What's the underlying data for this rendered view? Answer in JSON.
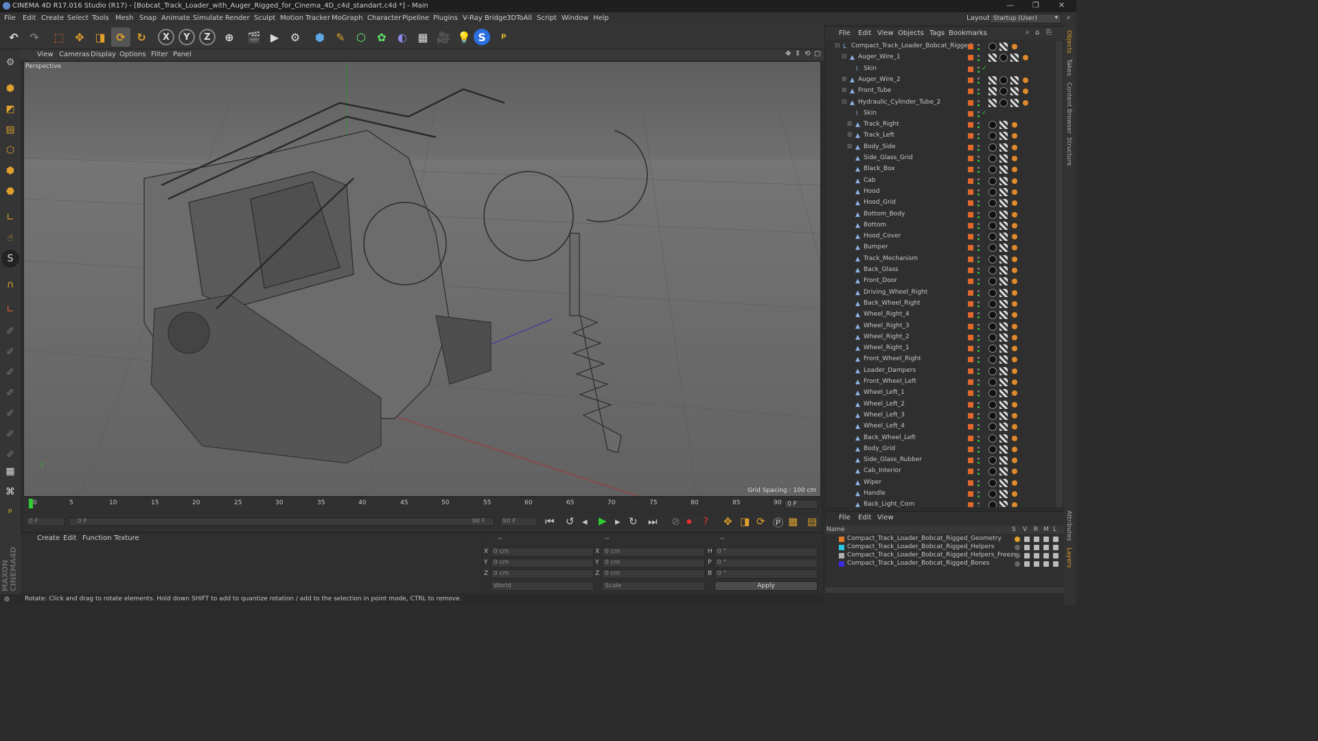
{
  "window": {
    "title": "CINEMA 4D R17.016 Studio (R17) - [Bobcat_Track_Loader_with_Auger_Rigged_for_Cinema_4D_c4d_standart.c4d *] - Main"
  },
  "menu": [
    "File",
    "Edit",
    "Create",
    "Select",
    "Tools",
    "Mesh",
    "Snap",
    "Animate",
    "Simulate",
    "Render",
    "Sculpt",
    "Motion Tracker",
    "MoGraph",
    "Character",
    "Pipeline",
    "Plugins",
    "V-Ray Bridge",
    "3DToAll",
    "Script",
    "Window",
    "Help"
  ],
  "layout": {
    "label": "Layout:",
    "value": "Startup (User)"
  },
  "viewport": {
    "menu": [
      "View",
      "Cameras",
      "Display",
      "Options",
      "Filter",
      "Panel"
    ],
    "label": "Perspective",
    "grid_spacing": "Grid Spacing : 100 cm"
  },
  "timeline": {
    "ticks": [
      "0",
      "5",
      "10",
      "15",
      "20",
      "25",
      "30",
      "35",
      "40",
      "45",
      "50",
      "55",
      "60",
      "65",
      "70",
      "75",
      "80",
      "85",
      "90"
    ],
    "end_field": "0 F",
    "start_frame": "0 F",
    "range_start": "0 F",
    "range_end": "90 F",
    "max_frame": "90 F"
  },
  "material_panel": {
    "menu": [
      "Create",
      "Edit",
      "Function",
      "Texture"
    ]
  },
  "coord_panel": {
    "header_left": "--",
    "header_mid": "--",
    "header_right": "--",
    "rows": [
      {
        "a": "X",
        "av": "0 cm",
        "b": "X",
        "bv": "0 cm",
        "c": "H",
        "cv": "0 °"
      },
      {
        "a": "Y",
        "av": "0 cm",
        "b": "Y",
        "bv": "0 cm",
        "c": "P",
        "cv": "0 °"
      },
      {
        "a": "Z",
        "av": "0 cm",
        "b": "Z",
        "bv": "0 cm",
        "c": "B",
        "cv": "0 °"
      }
    ],
    "world": "World",
    "scale": "Scale",
    "apply": "Apply"
  },
  "status": "Rotate: Click and drag to rotate elements. Hold down SHIFT to add to quantize rotation / add to the selection in point mode, CTRL to remove.",
  "object_manager": {
    "menu": [
      "File",
      "Edit",
      "View",
      "Objects",
      "Tags",
      "Bookmarks"
    ],
    "objects": [
      {
        "name": "Compact_Track_Loader_Bobcat_Rigged",
        "indent": 0,
        "type": "null"
      },
      {
        "name": "Auger_Wire_1",
        "indent": 1,
        "type": "bone"
      },
      {
        "name": "Skin",
        "indent": 2,
        "type": "skin"
      },
      {
        "name": "Auger_Wire_2",
        "indent": 1,
        "type": "bone"
      },
      {
        "name": "Front_Tube",
        "indent": 1,
        "type": "bone"
      },
      {
        "name": "Hydraulic_Cylinder_Tube_2",
        "indent": 1,
        "type": "bone"
      },
      {
        "name": "Skin",
        "indent": 2,
        "type": "skin"
      },
      {
        "name": "Track_Right",
        "indent": 2,
        "type": "bone"
      },
      {
        "name": "Track_Left",
        "indent": 2,
        "type": "bone"
      },
      {
        "name": "Body_Side",
        "indent": 2,
        "type": "bone"
      },
      {
        "name": "Side_Glass_Grid",
        "indent": 2,
        "type": "bone"
      },
      {
        "name": "Black_Box",
        "indent": 2,
        "type": "bone"
      },
      {
        "name": "Cab",
        "indent": 2,
        "type": "bone"
      },
      {
        "name": "Hood",
        "indent": 2,
        "type": "bone"
      },
      {
        "name": "Hood_Grid",
        "indent": 2,
        "type": "bone"
      },
      {
        "name": "Bottom_Body",
        "indent": 2,
        "type": "bone"
      },
      {
        "name": "Bottom",
        "indent": 2,
        "type": "bone"
      },
      {
        "name": "Hood_Cover",
        "indent": 2,
        "type": "bone"
      },
      {
        "name": "Bumper",
        "indent": 2,
        "type": "bone"
      },
      {
        "name": "Track_Mechanism",
        "indent": 2,
        "type": "bone"
      },
      {
        "name": "Back_Glass",
        "indent": 2,
        "type": "bone"
      },
      {
        "name": "Front_Door",
        "indent": 2,
        "type": "bone"
      },
      {
        "name": "Driving_Wheel_Right",
        "indent": 2,
        "type": "bone"
      },
      {
        "name": "Back_Wheel_Right",
        "indent": 2,
        "type": "bone"
      },
      {
        "name": "Wheel_Right_4",
        "indent": 2,
        "type": "bone"
      },
      {
        "name": "Wheel_Right_3",
        "indent": 2,
        "type": "bone"
      },
      {
        "name": "Wheel_Right_2",
        "indent": 2,
        "type": "bone"
      },
      {
        "name": "Wheel_Right_1",
        "indent": 2,
        "type": "bone"
      },
      {
        "name": "Front_Wheel_Right",
        "indent": 2,
        "type": "bone"
      },
      {
        "name": "Loader_Dampers",
        "indent": 2,
        "type": "bone"
      },
      {
        "name": "Front_Wheel_Left",
        "indent": 2,
        "type": "bone"
      },
      {
        "name": "Wheel_Left_1",
        "indent": 2,
        "type": "bone"
      },
      {
        "name": "Wheel_Left_2",
        "indent": 2,
        "type": "bone"
      },
      {
        "name": "Wheel_Left_3",
        "indent": 2,
        "type": "bone"
      },
      {
        "name": "Wheel_Left_4",
        "indent": 2,
        "type": "bone"
      },
      {
        "name": "Back_Wheel_Left",
        "indent": 2,
        "type": "bone"
      },
      {
        "name": "Body_Grid",
        "indent": 2,
        "type": "bone"
      },
      {
        "name": "Side_Glass_Rubber",
        "indent": 2,
        "type": "bone"
      },
      {
        "name": "Cab_Interior",
        "indent": 2,
        "type": "bone"
      },
      {
        "name": "Wiper",
        "indent": 2,
        "type": "bone"
      },
      {
        "name": "Handle",
        "indent": 2,
        "type": "bone"
      },
      {
        "name": "Back_Light_Corn",
        "indent": 2,
        "type": "bone"
      }
    ]
  },
  "layer_manager": {
    "menu": [
      "File",
      "Edit",
      "View"
    ],
    "header": {
      "name": "Name",
      "s": "S",
      "v": "V",
      "r": "R",
      "m": "M",
      "l": "L"
    },
    "layers": [
      {
        "name": "Compact_Track_Loader_Bobcat_Rigged_Geometry",
        "color": "#e07a2b"
      },
      {
        "name": "Compact_Track_Loader_Bobcat_Rigged_Helpers",
        "color": "#2bc6e0"
      },
      {
        "name": "Compact_Track_Loader_Bobcat_Rigged_Helpers_Freeze",
        "color": "#b0b0b0"
      },
      {
        "name": "Compact_Track_Loader_Bobcat_Rigged_Bones",
        "color": "#3a2be0"
      }
    ]
  },
  "right_tabs": [
    "Objects",
    "Takes",
    "Content Browser",
    "Structure",
    "Attributes",
    "Layers"
  ]
}
